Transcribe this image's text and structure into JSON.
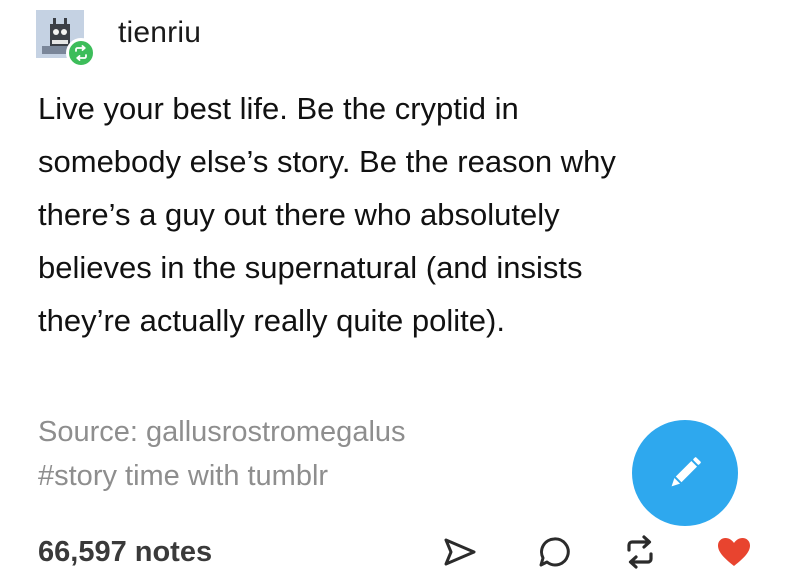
{
  "post": {
    "username": "tienriu",
    "body": "Live your best life.  Be the cryptid in\nsomebody else’s story.  Be the reason why\nthere’s a guy out there who absolutely\nbelieves in the supernatural (and insists\nthey’re actually really quite polite).",
    "source": "Source: gallusrostromegalus",
    "tags": "#story time with tumblr",
    "notes": "66,597 notes"
  },
  "icons": {
    "avatar": "avatar-image",
    "reblog_badge": "reblog-icon",
    "compose": "pencil-icon",
    "share": "share-icon",
    "reply": "reply-icon",
    "reblog": "reblog-icon",
    "like": "heart-icon"
  },
  "colors": {
    "fab": "#2ea8ee",
    "reblog_badge": "#3dbd5a",
    "heart": "#e8442f",
    "muted_text": "#8e8e8e"
  }
}
